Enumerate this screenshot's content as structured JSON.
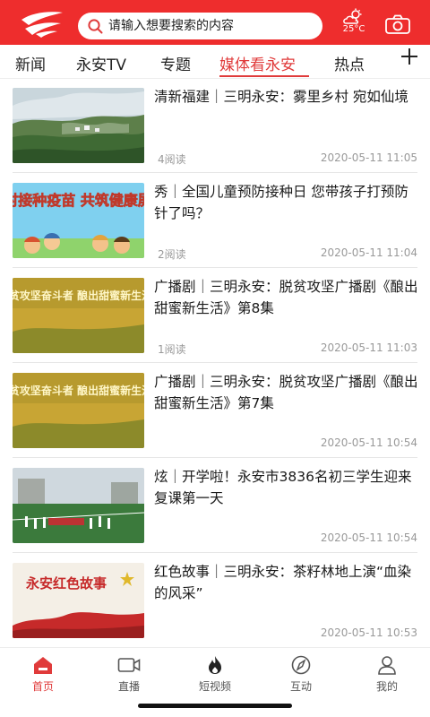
{
  "header": {
    "search_placeholder": "请输入想要搜索的内容",
    "temperature": "25°C",
    "colors": {
      "brand": "#ee2d2d",
      "accent": "#e03b3b"
    }
  },
  "tabs": [
    {
      "label": "新闻"
    },
    {
      "label": "永安TV"
    },
    {
      "label": "专题"
    },
    {
      "label": "媒体看永安",
      "active": true
    },
    {
      "label": "热点"
    }
  ],
  "feed": [
    {
      "title": "清新福建｜三明永安：雾里乡村 宛如仙境",
      "reads": "4阅读",
      "time": "2020-05-11 11:05",
      "thumb_icon": "misty-village-image"
    },
    {
      "title": "秀｜全国儿童预防接种日 您带孩子打预防针了吗？",
      "reads": "2阅读",
      "time": "2020-05-11 11:04",
      "thumb_icon": "vaccination-poster-image",
      "thumb_text": "及时接种疫苗 共筑健康屏障"
    },
    {
      "title": "广播剧｜三明永安：脱贫攻坚广播剧《酿出甜蜜新生活》第8集",
      "reads": "1阅读",
      "time": "2020-05-11 11:03",
      "thumb_icon": "radio-drama-poster-image",
      "thumb_text": "脱贫攻坚奋斗者 酿出甜蜜新生活"
    },
    {
      "title": "广播剧｜三明永安：脱贫攻坚广播剧《酿出甜蜜新生活》第7集",
      "reads": "",
      "time": "2020-05-11 10:54",
      "thumb_icon": "radio-drama-poster-image",
      "thumb_text": "脱贫攻坚奋斗者 酿出甜蜜新生活"
    },
    {
      "title": "炫｜开学啦！永安市3836名初三学生迎来复课第一天",
      "reads": "",
      "time": "2020-05-11 10:54",
      "thumb_icon": "school-opening-image"
    },
    {
      "title": "红色故事｜三明永安：茶籽林地上演“血染的风采”",
      "reads": "",
      "time": "2020-05-11 10:53",
      "thumb_icon": "red-story-poster-image",
      "thumb_text": "永安红色故事"
    }
  ],
  "bottom_nav": [
    {
      "label": "首页",
      "icon": "home-icon",
      "active": true
    },
    {
      "label": "直播",
      "icon": "video-camera-icon"
    },
    {
      "label": "短视频",
      "icon": "flame-icon"
    },
    {
      "label": "互动",
      "icon": "compass-icon"
    },
    {
      "label": "我的",
      "icon": "person-icon"
    }
  ]
}
